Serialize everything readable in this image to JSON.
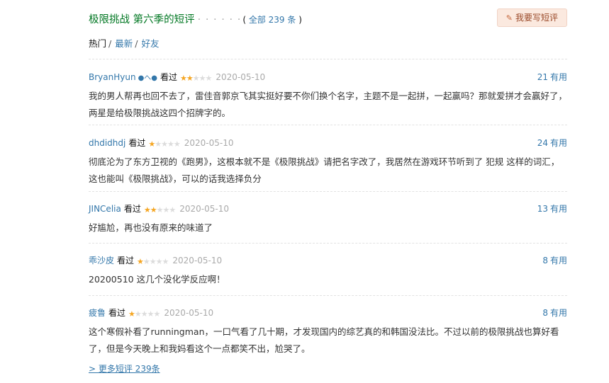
{
  "header": {
    "title": "极限挑战 第六季的短评",
    "dots": "· · · · · ·",
    "count_prefix": "(",
    "count_link": "全部 239 条",
    "count_suffix": ")",
    "write_button": "我要写短评",
    "write_icon": "pencil-icon"
  },
  "tabs": {
    "hot": "热门",
    "sep": "/",
    "latest": "最新",
    "friends": "好友"
  },
  "vote_unit": "有用",
  "comments": [
    {
      "user": "BryanHyun",
      "badge": "●へ●",
      "status": "看过",
      "rating": 2,
      "time": "2020-05-10",
      "votes": "21",
      "text": "我的男人帮再也回不去了，雷佳音郭京飞其实挺好要不你们换个名字，主题不是一起拼，一起赢吗？那就爱拼才会赢好了，两星是给极限挑战这四个招牌字的。"
    },
    {
      "user": "dhdidhdj",
      "badge": "",
      "status": "看过",
      "rating": 1,
      "time": "2020-05-10",
      "votes": "24",
      "text": "彻底沦为了东方卫视的《跑男》，这根本就不是《极限挑战》请把名字改了，我居然在游戏环节听到了 犯规 这样的词汇，这也能叫《极限挑战》，可以的话我选择负分"
    },
    {
      "user": "JINCelia",
      "badge": "",
      "status": "看过",
      "rating": 2,
      "time": "2020-05-10",
      "votes": "13",
      "text": "好尴尬，再也没有原来的味道了"
    },
    {
      "user": "乖沙皮",
      "badge": "",
      "status": "看过",
      "rating": 1,
      "time": "2020-05-10",
      "votes": "8",
      "text": "20200510 这几个没化学反应啊！"
    },
    {
      "user": "疲鲁",
      "badge": "",
      "status": "看过",
      "rating": 1,
      "time": "2020-05-10",
      "votes": "8",
      "text": "这个寒假补看了runningman，一口气看了几十期，才发现国内的综艺真的和韩国没法比。不过以前的极限挑战也算好看了，但是今天晚上和我妈看这个一点都笑不出，尬哭了。"
    }
  ],
  "more": {
    "label": "> 更多短评 239条"
  }
}
